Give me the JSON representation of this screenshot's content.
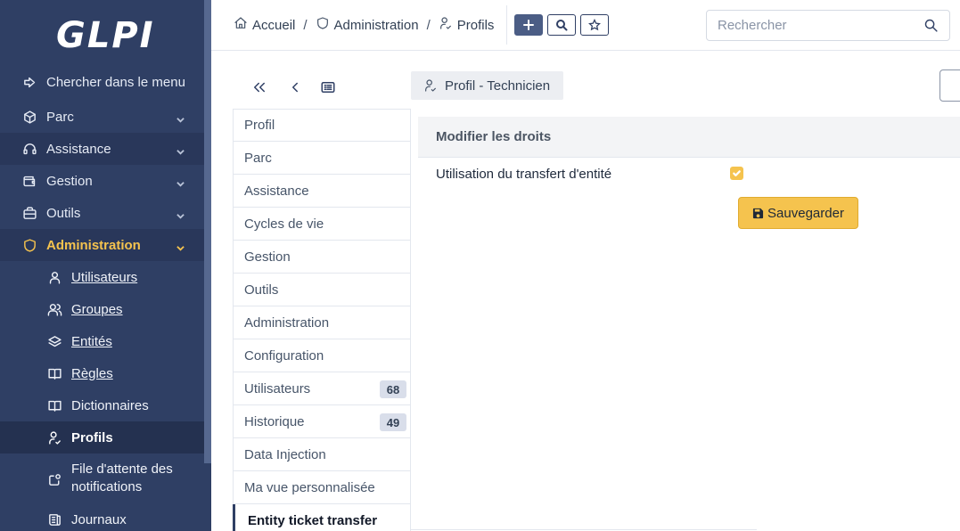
{
  "app": {
    "logo_text": "GLPI"
  },
  "sidebar": {
    "search_label": "Chercher dans le menu",
    "items": [
      {
        "label": "Parc",
        "icon": "box-icon"
      },
      {
        "label": "Assistance",
        "icon": "headset-icon"
      },
      {
        "label": "Gestion",
        "icon": "wallet-icon"
      },
      {
        "label": "Outils",
        "icon": "briefcase-icon"
      },
      {
        "label": "Administration",
        "icon": "shield-icon"
      }
    ],
    "sub_items": [
      {
        "label": "Utilisateurs",
        "icon": "user-icon"
      },
      {
        "label": "Groupes",
        "icon": "users-icon"
      },
      {
        "label": "Entités",
        "icon": "layers-icon"
      },
      {
        "label": "Règles",
        "icon": "book-icon"
      },
      {
        "label": "Dictionnaires",
        "icon": "book-open-icon"
      },
      {
        "label": "Profils",
        "icon": "user-check-icon"
      },
      {
        "label": "File d'attente des notifications",
        "label_line1": "File d'attente des",
        "label_line2": "notifications",
        "icon": "notification-icon"
      },
      {
        "label": "Journaux",
        "icon": "news-icon"
      }
    ]
  },
  "header": {
    "breadcrumb": [
      {
        "label": "Accueil",
        "icon": "home-icon"
      },
      {
        "label": "Administration",
        "icon": "shield-icon"
      },
      {
        "label": "Profils",
        "icon": "user-check-icon"
      }
    ],
    "breadcrumb_sep": "/",
    "search_placeholder": "Rechercher"
  },
  "profile_title": "Profil - Technicien",
  "tabs": [
    {
      "label": "Profil"
    },
    {
      "label": "Parc"
    },
    {
      "label": "Assistance"
    },
    {
      "label": "Cycles de vie"
    },
    {
      "label": "Gestion"
    },
    {
      "label": "Outils"
    },
    {
      "label": "Administration"
    },
    {
      "label": "Configuration"
    },
    {
      "label": "Utilisateurs",
      "badge": "68"
    },
    {
      "label": "Historique",
      "badge": "49"
    },
    {
      "label": "Data Injection"
    },
    {
      "label": "Ma vue personnalisée"
    },
    {
      "label": "Entity ticket transfer"
    }
  ],
  "panel": {
    "heading": "Modifier les droits",
    "right_label": "Utilisation du transfert d'entité",
    "right_checked": true,
    "save_label": "Sauvegarder"
  },
  "colors": {
    "sidebar": "#2f3f64",
    "accent": "#f5c34e"
  }
}
